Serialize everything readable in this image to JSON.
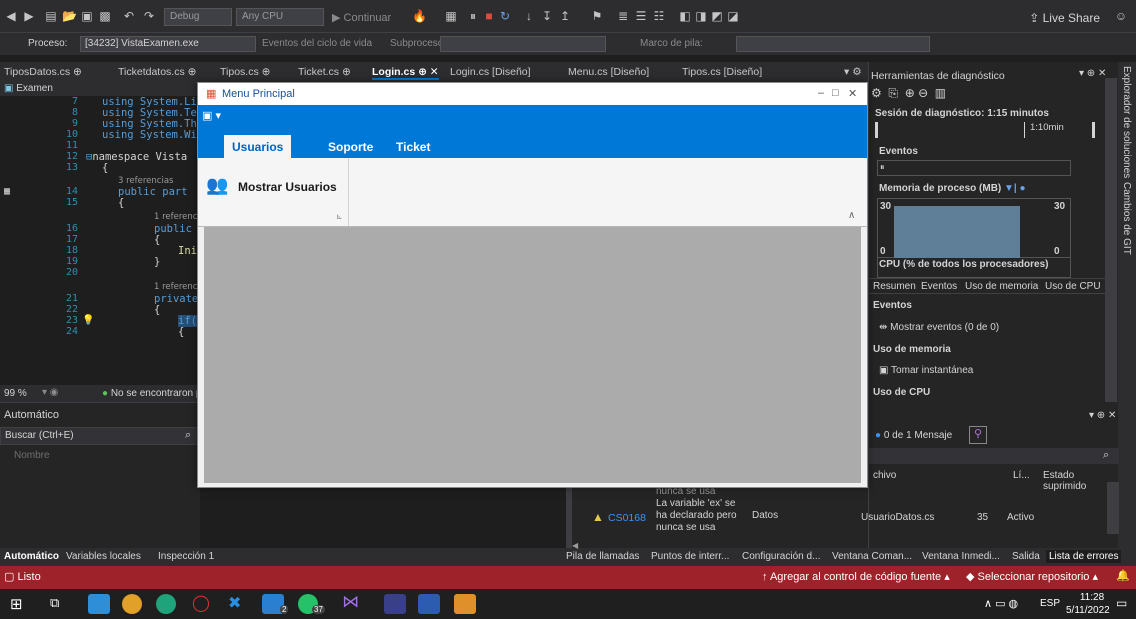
{
  "toolbar": {
    "config": "Debug",
    "platform": "Any CPU",
    "continue_label": "Continuar",
    "live_share": "Live Share"
  },
  "process_bar": {
    "process_label": "Proceso:",
    "process_value": "[34232] VistaExamen.exe",
    "lifecycle": "Eventos del ciclo de vida",
    "thread_label": "Subproceso:",
    "stack_label": "Marco de pila:"
  },
  "doc_tabs": [
    "TiposDatos.cs",
    "Ticketdatos.cs",
    "Tipos.cs",
    "Ticket.cs",
    "Login.cs",
    "Login.cs [Diseño]",
    "Menu.cs [Diseño]",
    "Tipos.cs [Diseño]"
  ],
  "editor": {
    "project": "Examen",
    "lines": [
      {
        "n": "7",
        "text": "using System.Li"
      },
      {
        "n": "8",
        "text": "using System.Te"
      },
      {
        "n": "9",
        "text": "using System.Th"
      },
      {
        "n": "10",
        "text": "using System.Wi"
      },
      {
        "n": "11",
        "text": ""
      },
      {
        "n": "12",
        "text": "namespace Vista"
      },
      {
        "n": "13",
        "text": "{"
      },
      {
        "n": "14",
        "text": "public part"
      },
      {
        "n": "15",
        "text": "{"
      },
      {
        "n": "16",
        "text": "public"
      },
      {
        "n": "17",
        "text": "{"
      },
      {
        "n": "18",
        "text": "Ini"
      },
      {
        "n": "19",
        "text": "}"
      },
      {
        "n": "20",
        "text": ""
      },
      {
        "n": "21",
        "text": "private"
      },
      {
        "n": "22",
        "text": "{"
      },
      {
        "n": "23",
        "text": "if("
      },
      {
        "n": "24",
        "text": "{"
      }
    ],
    "refs_3": "3 referencias",
    "refs_1a": "1 referenc",
    "refs_1b": "1 referenc",
    "zoom": "99 %",
    "issues": "No se encontraron p"
  },
  "auto_panel": {
    "title": "Automático",
    "search": "Buscar (Ctrl+E)",
    "column": "Nombre"
  },
  "bottom_tabs_left": [
    "Automático",
    "Variables locales",
    "Inspección 1"
  ],
  "bottom_tabs_right": [
    "Pila de llamadas",
    "Puntos de interr...",
    "Configuración d...",
    "Ventana Coman...",
    "Ventana Inmedi...",
    "Salida",
    "Lista de errores"
  ],
  "error": {
    "code": "CS0168",
    "msg_prev": "nunca se usa",
    "msg1": "La variable 'ex' se",
    "msg2": "ha declarado pero",
    "msg3": "nunca se usa",
    "project": "Datos",
    "file": "UsuarioDatos.cs",
    "line": "35",
    "state": "Activo"
  },
  "diag": {
    "title": "Herramientas de diagnóstico",
    "session": "Sesión de diagnóstico: 1:15 minutos",
    "time_mark": "1:10min",
    "events": "Eventos",
    "memory": "Memoria de proceso (MB)",
    "mem_max": "30",
    "mem_min": "0",
    "cpu": "CPU (% de todos los procesadores)",
    "subtabs": [
      "Resumen",
      "Eventos",
      "Uso de memoria",
      "Uso de CPU"
    ],
    "sec_events": "Eventos",
    "show_events": "Mostrar eventos (0 de 0)",
    "sec_memory": "Uso de memoria",
    "snapshot": "Tomar instantánea",
    "sec_cpu": "Uso de CPU"
  },
  "side_strip": [
    "Explorador de soluciones",
    "Cambios de GIT"
  ],
  "msg_panel": {
    "messages": "0 de 1 Mensaje",
    "col_file": "chivo",
    "col_line": "Lí...",
    "col_state": "Estado suprimido"
  },
  "statusbar": {
    "ready": "Listo",
    "source_control": "Agregar al control de código fuente",
    "repo": "Seleccionar repositorio"
  },
  "taskbar": {
    "badge_count": "2",
    "badge_count2": "37",
    "lang": "ESP",
    "time": "11:28",
    "date": "5/11/2022"
  },
  "winform": {
    "title": "Menu Principal",
    "tabs": [
      "Usuarios",
      "Soporte",
      "Ticket"
    ],
    "button": "Mostrar Usuarios"
  }
}
